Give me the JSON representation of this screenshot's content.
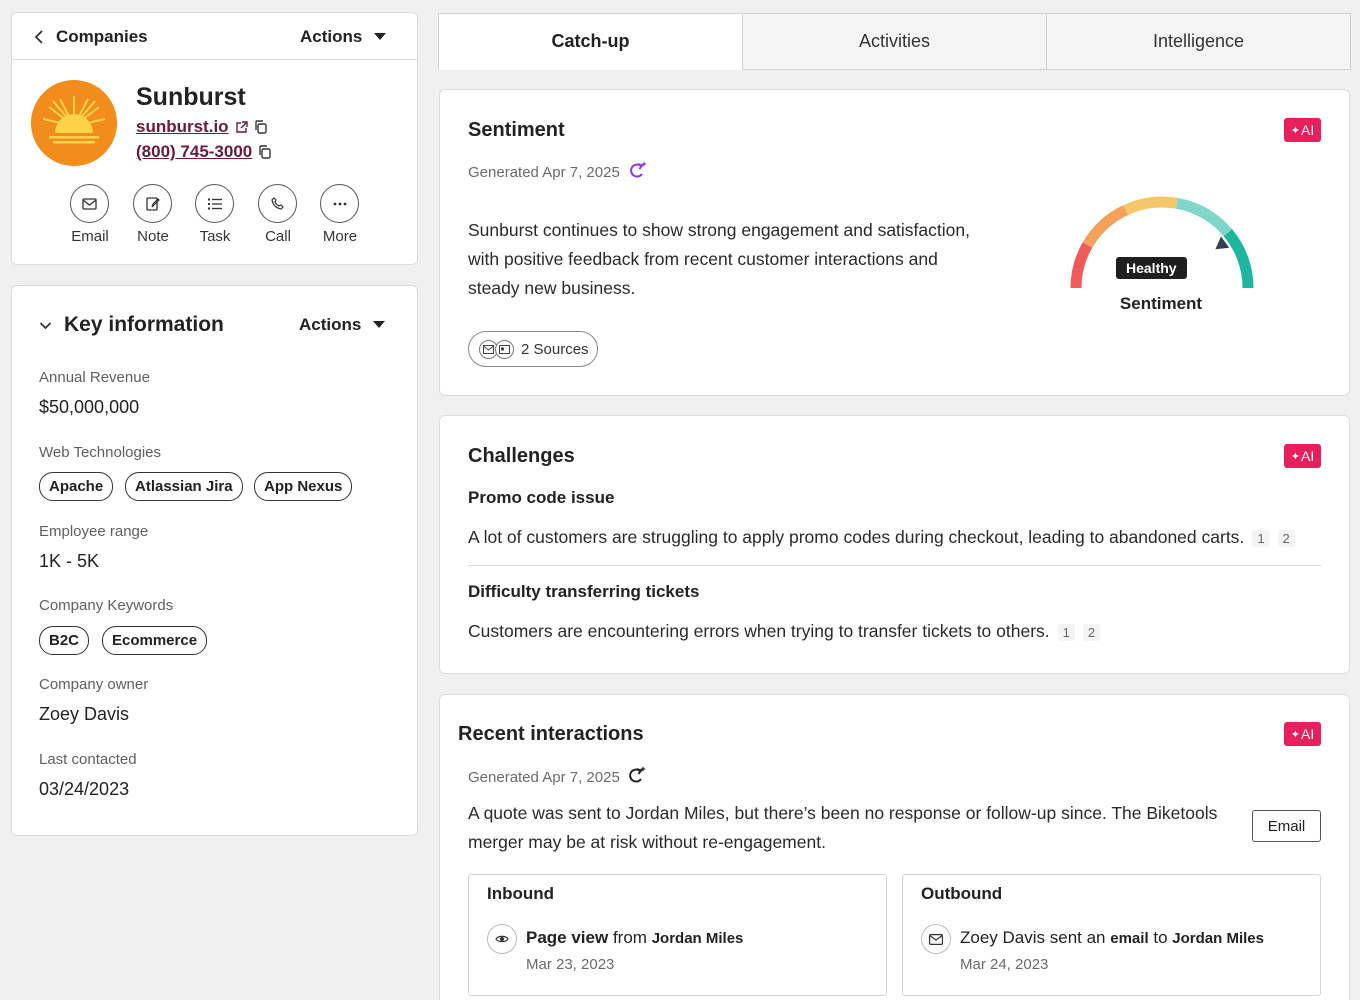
{
  "header": {
    "back_label": "Companies",
    "actions_label": "Actions"
  },
  "company": {
    "name": "Sunburst",
    "domain": "sunburst.io",
    "phone": "(800) 745-3000"
  },
  "quick_actions": [
    {
      "label": "Email",
      "icon": "mail-icon"
    },
    {
      "label": "Note",
      "icon": "note-icon"
    },
    {
      "label": "Task",
      "icon": "task-icon"
    },
    {
      "label": "Call",
      "icon": "phone-icon"
    },
    {
      "label": "More",
      "icon": "more-icon"
    }
  ],
  "key_info": {
    "title": "Key information",
    "actions_label": "Actions",
    "annual_revenue_label": "Annual Revenue",
    "annual_revenue": "$50,000,000",
    "web_tech_label": "Web Technologies",
    "web_tech": [
      "Apache",
      "Atlassian Jira",
      "App Nexus"
    ],
    "employee_range_label": "Employee range",
    "employee_range": "1K - 5K",
    "keywords_label": "Company Keywords",
    "keywords": [
      "B2C",
      "Ecommerce"
    ],
    "owner_label": "Company owner",
    "owner": "Zoey Davis",
    "last_contacted_label": "Last contacted",
    "last_contacted": "03/24/2023"
  },
  "tabs": [
    {
      "label": "Catch-up",
      "active": true
    },
    {
      "label": "Activities",
      "active": false
    },
    {
      "label": "Intelligence",
      "active": false
    }
  ],
  "ai_badge": "AI",
  "sentiment": {
    "title": "Sentiment",
    "generated": "Generated Apr 7, 2025",
    "text_lines": [
      "Sunburst continues to show strong engagement and satisfaction,",
      "with positive feedback from recent customer interactions and",
      "steady new business."
    ],
    "sources_label": "2 Sources",
    "gauge_status": "Healthy",
    "gauge_label": "Sentiment",
    "gauge_level": 0.8
  },
  "challenges": {
    "title": "Challenges",
    "items": [
      {
        "title": "Promo code issue",
        "text": "A lot of customers are struggling to apply promo codes during checkout, leading to abandoned carts.",
        "refs": [
          "1",
          "2"
        ]
      },
      {
        "title": "Difficulty transferring tickets",
        "text": "Customers are encountering errors when trying to transfer tickets to others.",
        "refs": [
          "1",
          "2"
        ]
      }
    ]
  },
  "recent": {
    "title": "Recent interactions",
    "generated": "Generated Apr 7, 2025",
    "text_lines": [
      "A quote was sent to Jordan Miles, but there’s been no response or follow-up since. The Biketools",
      "merger may be at risk without re-engagement."
    ],
    "email_button": "Email",
    "inbound": {
      "title": "Inbound",
      "strong": "Page view",
      "mid": "from",
      "person": "Jordan Miles",
      "date": "Mar 23, 2023"
    },
    "outbound": {
      "title": "Outbound",
      "pre": "Zoey Davis sent an",
      "strong": "email",
      "mid": "to",
      "person": "Jordan Miles",
      "date": "Mar 24, 2023"
    }
  },
  "colors": {
    "accent": "#e81f5c",
    "link": "#6a1a3a",
    "logo": "#f28c1b",
    "gauge_red": "#ef5b5b",
    "gauge_orange": "#f6a15b",
    "gauge_yellow": "#f5c66a",
    "gauge_teal": "#7fd6c9",
    "gauge_green": "#1fb6a0"
  }
}
